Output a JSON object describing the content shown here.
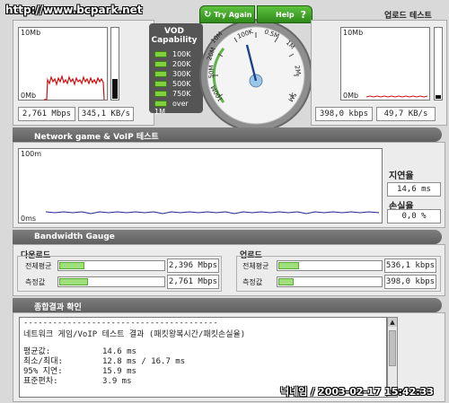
{
  "watermark_top": "http://www.bcpark.net",
  "watermark_bottom": "넉네임 / 2003-02-17 15:42:33",
  "download": {
    "graph_top": "10Mb",
    "graph_bottom": "0Mb",
    "speed_mbps": "2,761 Mbps",
    "speed_kbs": "345,1 KB/s"
  },
  "upload": {
    "title": "업로드 테스트",
    "graph_top": "10Mb",
    "graph_bottom": "0Mb",
    "speed_kbps": "398,0 kbps",
    "speed_kbs": "49,7 KB/s"
  },
  "vod": {
    "title_line1": "VOD",
    "title_line2": "Capability",
    "items": [
      "100K",
      "200K",
      "300K",
      "500K",
      "750K",
      "over 1M"
    ]
  },
  "gauge": {
    "try_again": "Try Again",
    "help": "Help",
    "help_mark": "?",
    "scale": [
      "10M",
      "100K",
      "0.5M",
      "1M",
      "2M",
      "5M",
      "100M",
      "50M",
      "20M"
    ],
    "needle_value_mbps": 2.761
  },
  "voip": {
    "section_title": "Network game & VoIP 테스트",
    "graph_top": "100m",
    "graph_bottom": "0ms",
    "latency_label": "지연율",
    "latency_value": "14,6 ms",
    "loss_label": "손실율",
    "loss_value": "0,0 %"
  },
  "bandwidth": {
    "section_title": "Bandwidth Gauge",
    "download_title": "다운로드",
    "upload_title": "업로드",
    "avg_label": "전체평균",
    "measured_label": "측정값",
    "download_avg": "2,396 Mbps",
    "download_measured": "2,761 Mbps",
    "upload_avg": "536,1 kbps",
    "upload_measured": "398,0 kbps",
    "download_avg_fill": 0.24,
    "download_measured_fill": 0.28,
    "upload_avg_fill": 0.2,
    "upload_measured_fill": 0.15
  },
  "result": {
    "section_title": "종합결과 확인",
    "separator": "----------------------------------------",
    "heading": "네트워크 게임/VoIP 테스트 결과 (패킷왕복시간/패킷손실율)",
    "rows": [
      {
        "label": "평균값:",
        "value": "14.6 ms"
      },
      {
        "label": "최소/최대:",
        "value": "12.8 ms / 16.7 ms"
      },
      {
        "label": "95% 지연:",
        "value": "15.9 ms"
      },
      {
        "label": "표준편차:",
        "value": "3.9 ms"
      }
    ]
  },
  "colors": {
    "accent_green": "#3f9a2a",
    "download_line": "#cc1111",
    "voip_line": "#22229a"
  }
}
